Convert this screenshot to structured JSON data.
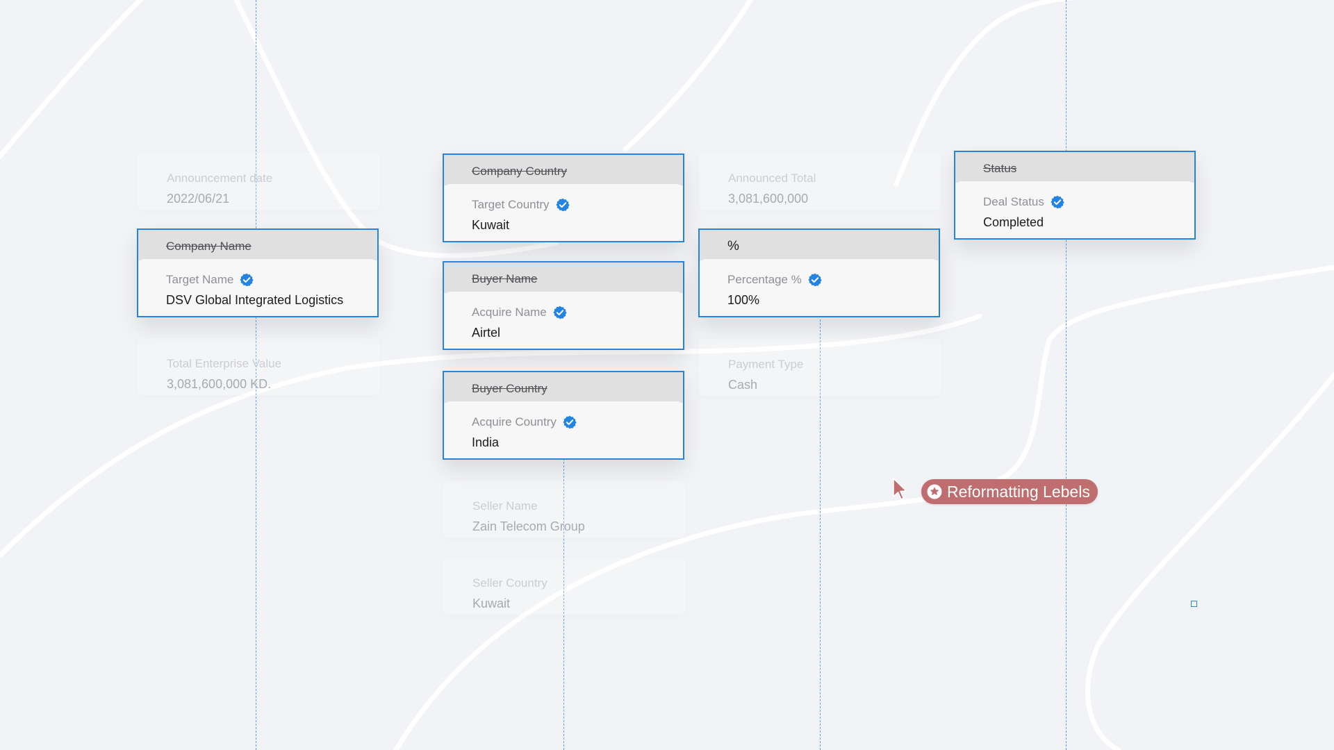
{
  "colors": {
    "background": "#f2f3f6",
    "accent": "#2683e2",
    "verified": "#2383e2",
    "tag": "#bf6d6f"
  },
  "faded_fields": [
    {
      "label": "Announcement date",
      "value": "2022/06/21"
    },
    {
      "label": "Total Enterprise Value",
      "value": "3,081,600,000 KD."
    },
    {
      "label": "Announced Total",
      "value": "3,081,600,000"
    },
    {
      "label": "Payment Type",
      "value": "Cash"
    },
    {
      "label": "Seller Name",
      "value": "Zain Telecom Group"
    },
    {
      "label": "Seller Country",
      "value": "Kuwait"
    }
  ],
  "mapped_cards": [
    {
      "old_label": "Company Name",
      "new_label": "Target Name",
      "value": "DSV Global Integrated Logistics",
      "icon": "verified-check-icon"
    },
    {
      "old_label": "Company Country",
      "new_label": "Target Country",
      "value": "Kuwait",
      "icon": "verified-check-icon"
    },
    {
      "old_label": "Buyer Name",
      "new_label": "Acquire Name",
      "value": "Airtel",
      "icon": "verified-check-icon"
    },
    {
      "old_label": "Buyer Country",
      "new_label": "Acquire Country",
      "value": "India",
      "icon": "verified-check-icon"
    },
    {
      "old_label": "%",
      "new_label": "Percentage %",
      "value": "100%",
      "icon": "verified-check-icon"
    },
    {
      "old_label": "Status",
      "new_label": "Deal Status",
      "value": "Completed",
      "icon": "verified-check-icon"
    }
  ],
  "tag": {
    "label": "Reformatting Lebels",
    "icon": "star-badge-icon"
  },
  "cursor": {
    "icon": "pointer-cursor-icon"
  }
}
